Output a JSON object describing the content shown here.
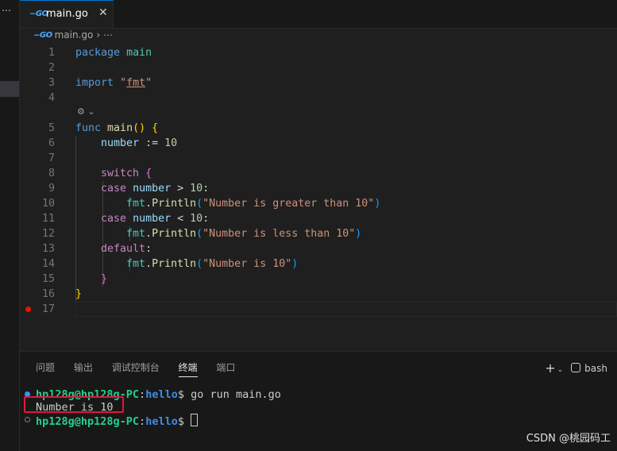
{
  "sidebar": {
    "menu_glyph": "⋯"
  },
  "tab": {
    "icon": "~GO",
    "label": "main.go",
    "close": "✕"
  },
  "breadcrumb": {
    "icon": "~GO",
    "file": "main.go",
    "sep": "›",
    "more": "⋯"
  },
  "editor": {
    "line_numbers": [
      "1",
      "2",
      "3",
      "4",
      "5",
      "6",
      "7",
      "8",
      "9",
      "10",
      "11",
      "12",
      "13",
      "14",
      "15",
      "16",
      "17"
    ],
    "codelens": "⚙ ⌄",
    "code": {
      "l1_kw": "package",
      "l1_id": "main",
      "l3_kw": "import",
      "l3_q1": "\"",
      "l3_pkg": "fmt",
      "l3_q2": "\"",
      "l5_kw": "func",
      "l5_fn": "main",
      "l5_p": "()",
      "l5_b": "{",
      "l6_var": "number",
      "l6_op": ":=",
      "l6_num": "10",
      "l8_kw": "switch",
      "l8_b": "{",
      "l9_kw": "case",
      "l9_var": "number",
      "l9_op": ">",
      "l9_num": "10",
      "l9_c": ":",
      "l10_pkg": "fmt",
      "l10_dot": ".",
      "l10_fn": "Println",
      "l10_o": "(",
      "l10_str": "\"Number is greater than 10\"",
      "l10_c": ")",
      "l11_kw": "case",
      "l11_var": "number",
      "l11_op": "<",
      "l11_num": "10",
      "l11_c": ":",
      "l12_pkg": "fmt",
      "l12_dot": ".",
      "l12_fn": "Println",
      "l12_o": "(",
      "l12_str": "\"Number is less than 10\"",
      "l12_c": ")",
      "l13_kw": "default",
      "l13_c": ":",
      "l14_pkg": "fmt",
      "l14_dot": ".",
      "l14_fn": "Println",
      "l14_o": "(",
      "l14_str": "\"Number is 10\"",
      "l14_c": ")",
      "l15_b": "}",
      "l16_b": "}"
    }
  },
  "panel": {
    "tabs": [
      "问题",
      "输出",
      "调试控制台",
      "终端",
      "端口"
    ],
    "active_tab": "终端",
    "actions": {
      "new": "+",
      "dropdown": "⌄",
      "shell": "bash"
    }
  },
  "terminal": {
    "line1": {
      "user": "hp128g@hp128g-PC",
      "colon": ":",
      "path": "hello",
      "prompt": "$ ",
      "cmd": "go run main.go"
    },
    "line2": {
      "output": "Number is 10"
    },
    "line3": {
      "user": "hp128g@hp128g-PC",
      "colon": ":",
      "path": "hello",
      "prompt": "$ "
    }
  },
  "watermark": "CSDN @桃园码工",
  "colors": {
    "accent": "#0078d4",
    "breakpoint": "#e51400",
    "highlight_box": "#e0173c",
    "terminal_user": "#23d18b",
    "terminal_path": "#3b8eea"
  }
}
